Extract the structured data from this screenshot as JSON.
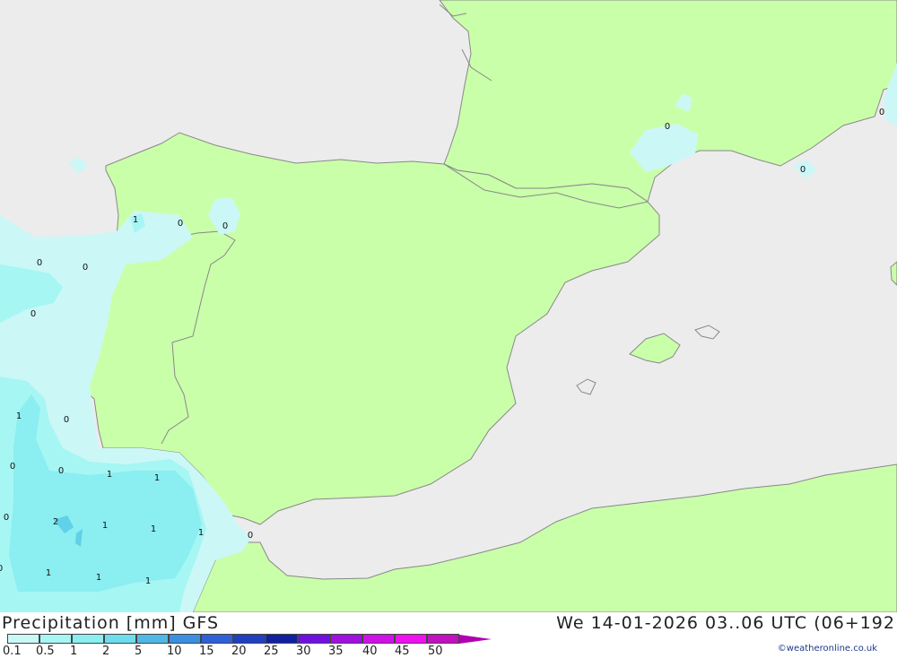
{
  "map": {
    "colors": {
      "sea": "#ececec",
      "land": "#caffaa",
      "border": "#888888",
      "precip_light": "#ccf7f7",
      "precip_mid": "#a6f6f4",
      "precip_high": "#8beef0",
      "precip_max": "#5fd1e8"
    },
    "values": [
      "0",
      "1",
      "0",
      "0",
      "0",
      "0",
      "0",
      "0",
      "0",
      "0",
      "1",
      "0",
      "0",
      "0",
      "1",
      "1",
      "0",
      "2",
      "1",
      "1",
      "1",
      "0",
      "1",
      "1",
      "1",
      "1"
    ]
  },
  "footer": {
    "title": "Precipitation [mm] GFS",
    "time": "We 14-01-2026 03..06 UTC (06+192",
    "credit": "©weatheronline.co.uk",
    "legend": {
      "labels": [
        "0.1",
        "0.5",
        "1",
        "2",
        "5",
        "10",
        "15",
        "20",
        "25",
        "30",
        "35",
        "40",
        "45",
        "50"
      ],
      "colors": [
        "#ccf7f7",
        "#a6f6f4",
        "#8beef0",
        "#6ddcec",
        "#50b8e6",
        "#3a8fe0",
        "#3060d8",
        "#2040c0",
        "#1020a0",
        "#7010e0",
        "#a010e0",
        "#d010e8",
        "#f010f0",
        "#c010c0"
      ]
    }
  }
}
